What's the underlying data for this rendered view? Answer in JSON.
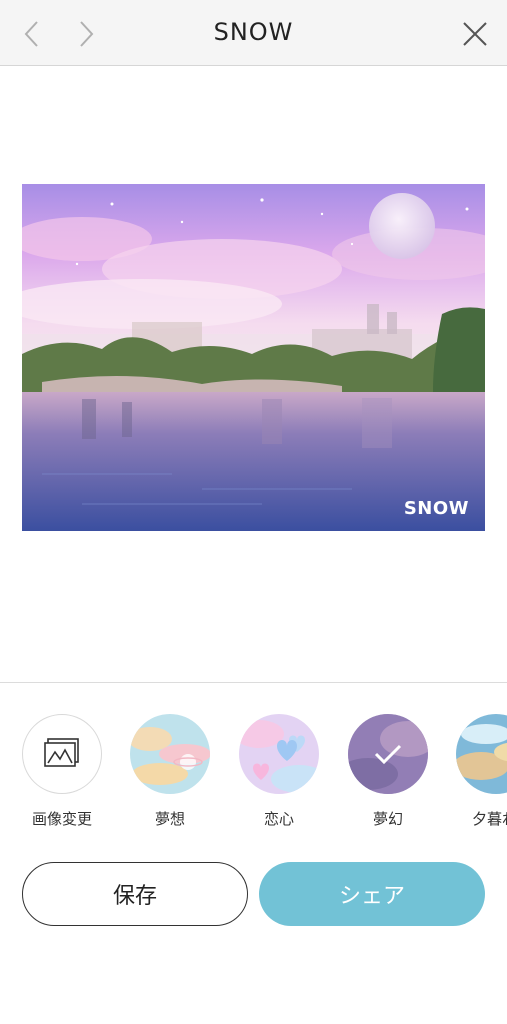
{
  "header": {
    "title": "SNOW"
  },
  "photo": {
    "watermark": "SNOW"
  },
  "filters": [
    {
      "label": "画像変更",
      "icon": "image-icon"
    },
    {
      "label": "夢想"
    },
    {
      "label": "恋心"
    },
    {
      "label": "夢幻",
      "selected": true
    },
    {
      "label": "夕暮れ"
    }
  ],
  "actions": {
    "save_label": "保存",
    "share_label": "シェア"
  },
  "colors": {
    "share_button": "#72c2d6",
    "nav_background": "#f5f5f5"
  }
}
